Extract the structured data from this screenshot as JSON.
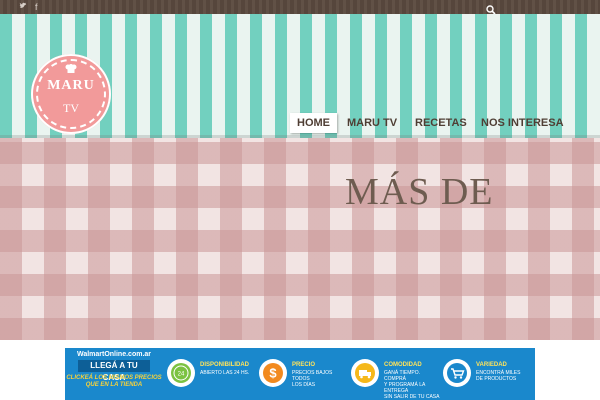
{
  "topbar": {
    "twitter_icon": "twitter-icon",
    "facebook_icon": "facebook-icon",
    "search_icon": "search-icon",
    "twitter_glyph": "🐦",
    "facebook_glyph": "f"
  },
  "logo": {
    "name": "MARU",
    "tv": "TV",
    "icon": "chef-hat-icon"
  },
  "nav": {
    "items": [
      {
        "label": "HOME",
        "active": true
      },
      {
        "label": "MARU TV"
      },
      {
        "label": "RECETAS"
      },
      {
        "label": "NOS INTERESA"
      }
    ]
  },
  "hero": {
    "headline": "MÁS DE"
  },
  "banner": {
    "brand": "WalmartOnline.com.ar",
    "llega": "LLEGÁ A TU CASA",
    "click": "CLICKEÁ LOS MISMOS PRECIOS QUE EN LA TIENDA",
    "features": [
      {
        "title": "DISPONIBILIDAD",
        "desc": "ABIERTO LAS 24 HS.",
        "icon": "clock-24-icon",
        "color": "#7cc242"
      },
      {
        "title": "PRECIO",
        "desc": "PRECIOS BAJOS TODOS\nLOS DÍAS",
        "icon": "dollar-icon",
        "color": "#f28a1f"
      },
      {
        "title": "COMODIDAD",
        "desc": "GANÁ TIEMPO. COMPRÁ\nY PROGRAMÁ LA ENTREGA\nSIN SALIR DE TU CASA",
        "icon": "truck-icon",
        "color": "#f5b81a"
      },
      {
        "title": "VARIEDAD",
        "desc": "ENCONTRÁ MILES\nDE PRODUCTOS",
        "icon": "cart-icon",
        "color": "#1a88cc"
      }
    ]
  },
  "colors": {
    "stripe_teal": "#72d0bf",
    "wood": "#5b4a3f",
    "logo_pink": "#f29a9a",
    "gingham": "#c99696",
    "banner_blue": "#1a88cc"
  }
}
